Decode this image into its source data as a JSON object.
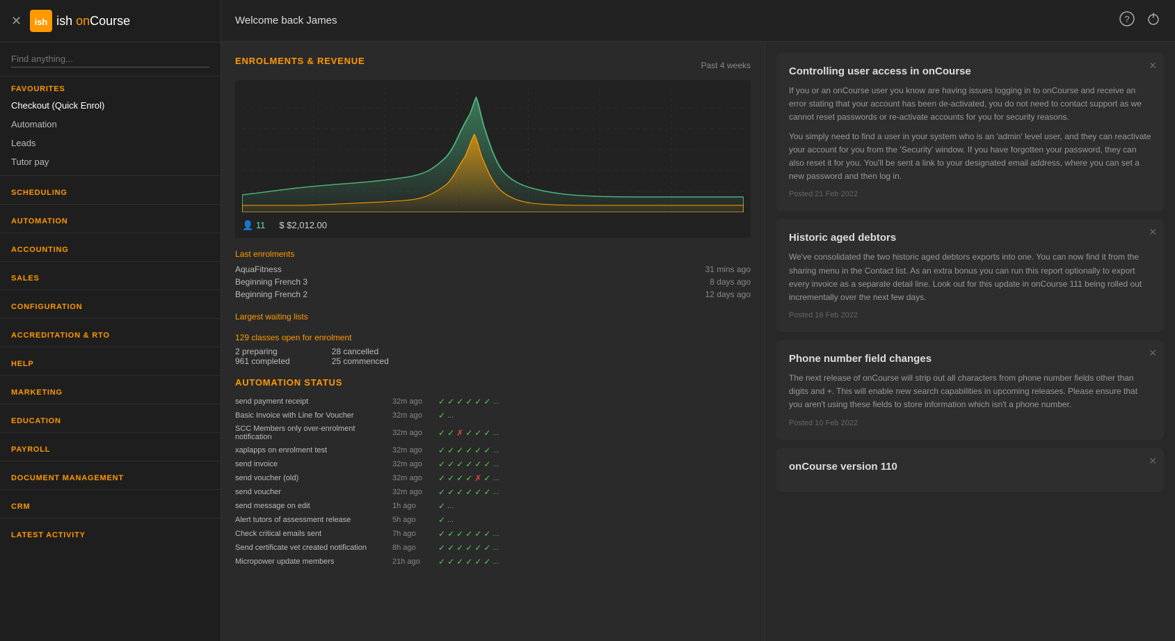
{
  "header": {
    "welcome": "Welcome back James",
    "close_label": "×"
  },
  "logo": {
    "icon_text": "ish",
    "text": "ish",
    "subtext": " onCourse"
  },
  "search": {
    "placeholder": "Find anything..."
  },
  "sidebar": {
    "sections": [
      {
        "label": "FAVOURITES",
        "items": [
          {
            "id": "checkout",
            "label": "Checkout (Quick Enrol)"
          },
          {
            "id": "automation",
            "label": "Automation"
          },
          {
            "id": "leads",
            "label": "Leads"
          },
          {
            "id": "tutor-pay",
            "label": "Tutor pay"
          }
        ]
      },
      {
        "label": "SCHEDULING",
        "items": []
      },
      {
        "label": "AUTOMATION",
        "items": []
      },
      {
        "label": "ACCOUNTING",
        "items": []
      },
      {
        "label": "SALES",
        "items": []
      },
      {
        "label": "CONFIGURATION",
        "items": []
      },
      {
        "label": "ACCREDITATION & RTO",
        "items": []
      },
      {
        "label": "HELP",
        "items": []
      },
      {
        "label": "MARKETING",
        "items": []
      },
      {
        "label": "EDUCATION",
        "items": []
      },
      {
        "label": "PAYROLL",
        "items": []
      },
      {
        "label": "DOCUMENT MANAGEMENT",
        "items": []
      },
      {
        "label": "CRM",
        "items": []
      }
    ],
    "latest_activity_label": "LATEST ACTIVITY"
  },
  "dashboard": {
    "enrolments_title": "ENROLMENTS & REVENUE",
    "period_label": "Past 4 weeks",
    "stats": {
      "people_count": "11",
      "revenue": "$2,012.00"
    },
    "last_enrolments_label": "Last enrolments",
    "enrolments": [
      {
        "name": "AquaFitness",
        "time": "31 mins ago"
      },
      {
        "name": "Beginning French 3",
        "time": "8 days ago"
      },
      {
        "name": "Beginning French 2",
        "time": "12 days ago"
      }
    ],
    "waiting_lists_label": "Largest waiting lists",
    "open_enrolment_label": "129 classes open for enrolment",
    "stats_grid": [
      {
        "label": "2 preparing",
        "label2": "28 cancelled"
      },
      {
        "label": "961 completed",
        "label2": "25 commenced"
      }
    ],
    "automation_title": "AUTOMATION STATUS",
    "automation_rows": [
      {
        "name": "send payment receipt",
        "time": "32m ago",
        "checks": [
          "ok",
          "ok",
          "ok",
          "ok",
          "ok",
          "ok"
        ],
        "more": true,
        "fail_at": []
      },
      {
        "name": "Basic Invoice with Line for Voucher",
        "time": "32m ago",
        "checks": [
          "ok"
        ],
        "more": true,
        "fail_at": []
      },
      {
        "name": "SCC Members only over-enrolment notification",
        "time": "32m ago",
        "checks": [
          "ok",
          "ok",
          "fail",
          "ok",
          "ok",
          "ok"
        ],
        "more": true,
        "fail_at": [
          2
        ]
      },
      {
        "name": "xaplapps on enrolment test",
        "time": "32m ago",
        "checks": [
          "ok",
          "ok",
          "ok",
          "ok",
          "ok",
          "ok"
        ],
        "more": true,
        "fail_at": []
      },
      {
        "name": "send invoice",
        "time": "32m ago",
        "checks": [
          "ok",
          "ok",
          "ok",
          "ok",
          "ok",
          "ok"
        ],
        "more": true,
        "fail_at": []
      },
      {
        "name": "send voucher (old)",
        "time": "32m ago",
        "checks": [
          "ok",
          "ok",
          "ok",
          "ok",
          "fail",
          "ok"
        ],
        "more": true,
        "fail_at": [
          4
        ]
      },
      {
        "name": "send voucher",
        "time": "32m ago",
        "checks": [
          "ok",
          "ok",
          "ok",
          "ok",
          "ok",
          "ok"
        ],
        "more": true,
        "fail_at": []
      },
      {
        "name": "send message on edit",
        "time": "1h ago",
        "checks": [
          "ok"
        ],
        "more": true,
        "fail_at": []
      },
      {
        "name": "Alert tutors of assessment release",
        "time": "5h ago",
        "checks": [
          "ok"
        ],
        "more": true,
        "fail_at": []
      },
      {
        "name": "Check critical emails sent",
        "time": "7h ago",
        "checks": [
          "ok",
          "ok",
          "ok",
          "ok",
          "ok",
          "ok"
        ],
        "more": true,
        "fail_at": []
      },
      {
        "name": "Send certificate vet created notification",
        "time": "8h ago",
        "checks": [
          "ok",
          "ok",
          "ok",
          "ok",
          "ok",
          "ok"
        ],
        "more": true,
        "fail_at": []
      },
      {
        "name": "Micropower update members",
        "time": "21h ago",
        "checks": [
          "ok",
          "ok",
          "ok",
          "ok",
          "ok",
          "ok"
        ],
        "more": true,
        "fail_at": []
      }
    ]
  },
  "news": {
    "cards": [
      {
        "id": "access-control",
        "title": "Controlling user access in onCourse",
        "paragraphs": [
          "If you or an onCourse user you know are having issues logging in to onCourse and receive an error stating that your account has been de-activated, you do not need to contact support as we cannot reset passwords or re-activate accounts for you for security reasons.",
          "You simply need to find a user in your system who is an 'admin' level user, and they can reactivate your account for you from the 'Security' window. If you have forgotten your password, they can also reset it for you. You'll be sent a link to your designated email address, where you can set a new password and then log in."
        ],
        "posted": "Posted 21 Feb 2022"
      },
      {
        "id": "aged-debtors",
        "title": "Historic aged debtors",
        "paragraphs": [
          "We've consolidated the two historic aged debtors exports into one. You can now find it from the sharing menu in the Contact list. As an extra bonus you can run this report optionally to export every invoice as a separate detail line. Look out for this update in onCourse 111 being rolled out incrementally over the next few days."
        ],
        "posted": "Posted 18 Feb 2022"
      },
      {
        "id": "phone-changes",
        "title": "Phone number field changes",
        "paragraphs": [
          "The next release of onCourse will strip out all characters from phone number fields other than digits and +. This will enable new search capabilities in upcoming releases. Please ensure that you aren't using these fields to store information which isn't a phone number."
        ],
        "posted": "Posted 10 Feb 2022"
      },
      {
        "id": "version-110",
        "title": "onCourse version 110",
        "paragraphs": [],
        "posted": ""
      }
    ]
  }
}
